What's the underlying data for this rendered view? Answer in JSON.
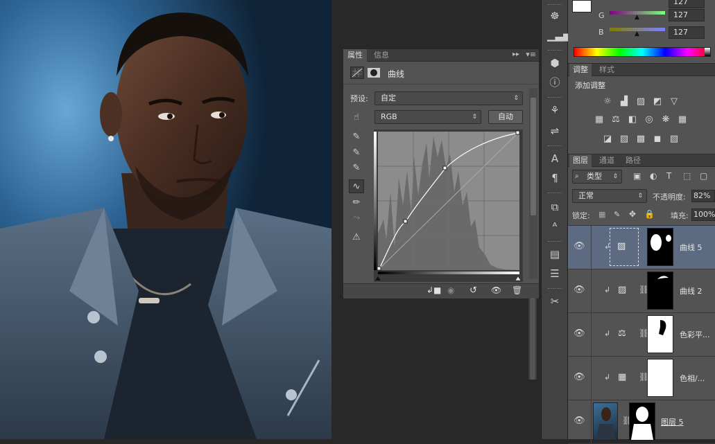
{
  "properties_panel": {
    "tabs": [
      "属性",
      "信息"
    ],
    "title": "曲线",
    "preset_label": "预设:",
    "preset_value": "自定",
    "channel_value": "RGB",
    "auto_button": "自动"
  },
  "color_panel": {
    "channels": [
      {
        "label": "G",
        "value": "127"
      },
      {
        "label": "B",
        "value": "127"
      }
    ]
  },
  "adjustments_panel": {
    "tabs": [
      "调整",
      "样式"
    ],
    "heading": "添加调整"
  },
  "layers_panel": {
    "tabs": [
      "图层",
      "通道",
      "路径"
    ],
    "filter_label": "类型",
    "blend_mode": "正常",
    "opacity_label": "不透明度:",
    "opacity_value": "82%",
    "lock_label": "锁定:",
    "fill_label": "填充:",
    "fill_value": "100%",
    "layers": [
      {
        "name": "曲线 5",
        "selected": true
      },
      {
        "name": "曲线 2",
        "selected": false
      },
      {
        "name": "色彩平...",
        "selected": false
      },
      {
        "name": "色相/...",
        "selected": false
      },
      {
        "name": "图层 5",
        "selected": false
      }
    ]
  },
  "colors": {
    "selection": "#5c6b82",
    "panel": "#535353"
  }
}
